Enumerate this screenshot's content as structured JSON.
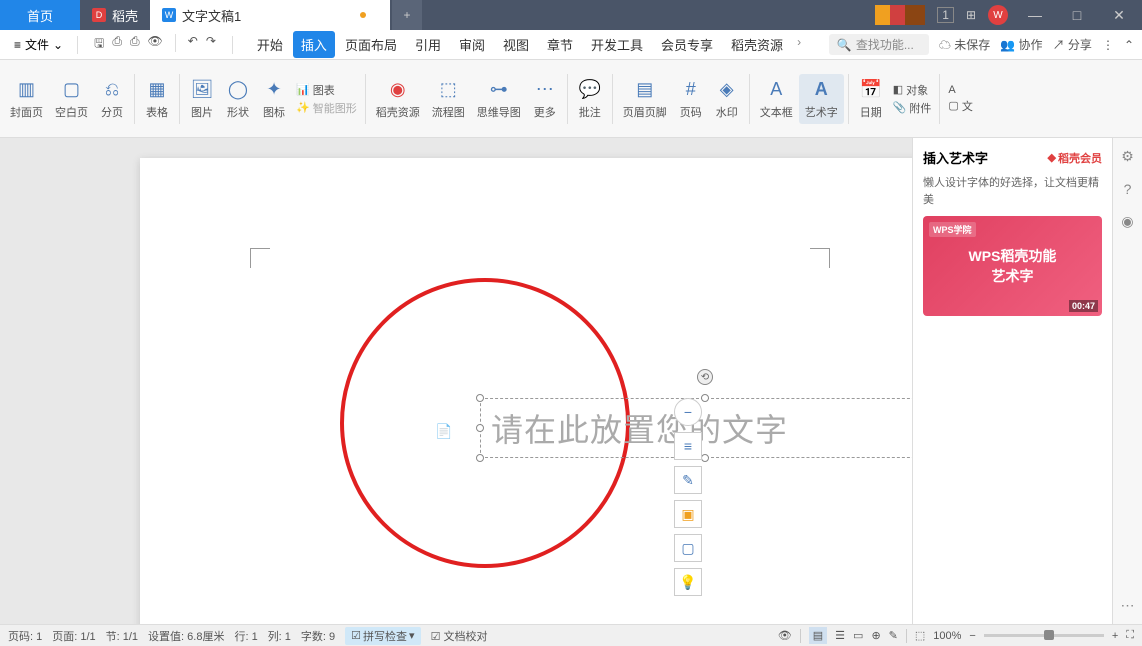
{
  "titlebar": {
    "tabs": {
      "home": "首页",
      "docer": "稻壳",
      "doc": "文字文稿1"
    },
    "add": "+",
    "window_num": "1"
  },
  "menubar": {
    "file": "文件",
    "tabs": [
      "开始",
      "插入",
      "页面布局",
      "引用",
      "审阅",
      "视图",
      "章节",
      "开发工具",
      "会员专享",
      "稻壳资源"
    ],
    "active_tab_index": 1,
    "search_placeholder": "查找功能...",
    "unsaved": "未保存",
    "coop": "协作",
    "share": "分享"
  },
  "ribbon": {
    "cover": "封面页",
    "blank": "空白页",
    "pagebreak": "分页",
    "table": "表格",
    "picture": "图片",
    "shape": "形状",
    "icon": "图标",
    "chart": "图表",
    "smart": "智能图形",
    "docer_res": "稻壳资源",
    "flowchart": "流程图",
    "mindmap": "思维导图",
    "more": "更多",
    "comment": "批注",
    "header_footer": "页眉页脚",
    "pagenum": "页码",
    "watermark": "水印",
    "textbox": "文本框",
    "wordart": "艺术字",
    "date": "日期",
    "object": "对象",
    "attach": "附件",
    "doc_parts": "文"
  },
  "document": {
    "placeholder_text": "请在此放置您的文字"
  },
  "side_panel": {
    "title": "插入艺术字",
    "badge": "稻壳会员",
    "description": "懒人设计字体的好选择，让文档更精美",
    "banner_label": "WPS学院",
    "banner_line1": "WPS稻壳功能",
    "banner_line2": "艺术字",
    "banner_time": "00:47"
  },
  "statusbar": {
    "page_code": "页码: 1",
    "page": "页面: 1/1",
    "section": "节: 1/1",
    "position": "设置值: 6.8厘米",
    "row": "行: 1",
    "col": "列: 1",
    "words": "字数: 9",
    "spell": "拼写检查",
    "proof": "文档校对",
    "zoom": "100%"
  }
}
